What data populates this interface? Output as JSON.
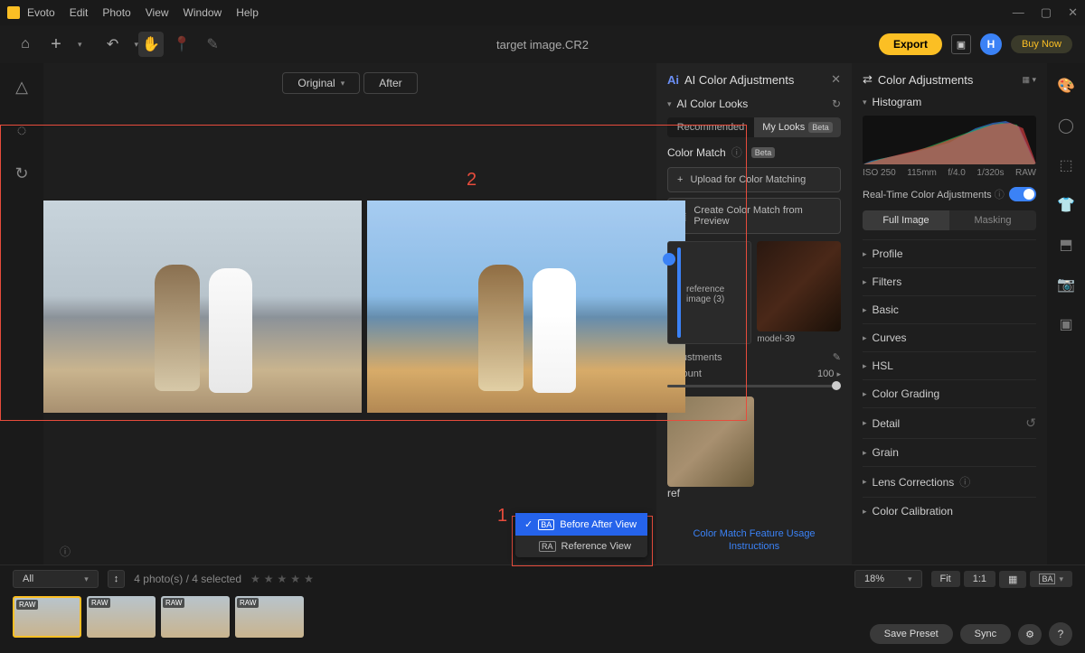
{
  "menu": [
    "Evoto",
    "Edit",
    "Photo",
    "View",
    "Window",
    "Help"
  ],
  "toolbar": {
    "title": "target image.CR2",
    "export": "Export",
    "buy": "Buy Now",
    "avatar": "H"
  },
  "view": {
    "original": "Original",
    "after": "After"
  },
  "annotations": {
    "one": "1",
    "two": "2"
  },
  "ai_panel": {
    "title": "AI Color Adjustments",
    "looks": "AI Color Looks",
    "tabs": {
      "recommended": "Recommended",
      "mylooks": "My Looks",
      "beta": "Beta"
    },
    "colormatch": "Color Match",
    "cm_beta": "Beta",
    "upload": "Upload for Color Matching",
    "create": "Create Color Match from Preview",
    "ref_label": "reference image (3)",
    "model_label": "model-39",
    "adjustments": "Adjustments",
    "amount": "Amount",
    "amount_val": "100",
    "ref2": "ref",
    "instructions": "Color Match Feature Usage Instructions"
  },
  "color_panel": {
    "title": "Color Adjustments",
    "histogram": "Histogram",
    "meta": {
      "iso": "ISO 250",
      "focal": "115mm",
      "ap": "f/4.0",
      "sh": "1/320s",
      "fmt": "RAW"
    },
    "realtime": "Real-Time Color Adjustments",
    "seg": {
      "full": "Full Image",
      "mask": "Masking"
    },
    "sections": [
      "Profile",
      "Filters",
      "Basic",
      "Curves",
      "HSL",
      "Color Grading",
      "Detail",
      "Grain",
      "Lens Corrections",
      "Color Calibration"
    ],
    "save": "Save Preset",
    "sync": "Sync"
  },
  "footer": {
    "filter": "All",
    "count": "4 photo(s) / 4 selected",
    "zoom_pct": "18%",
    "fit": "Fit",
    "oneone": "1:1",
    "menu": {
      "before": "Before After View",
      "reference": "Reference View"
    },
    "badge": "RAW"
  }
}
